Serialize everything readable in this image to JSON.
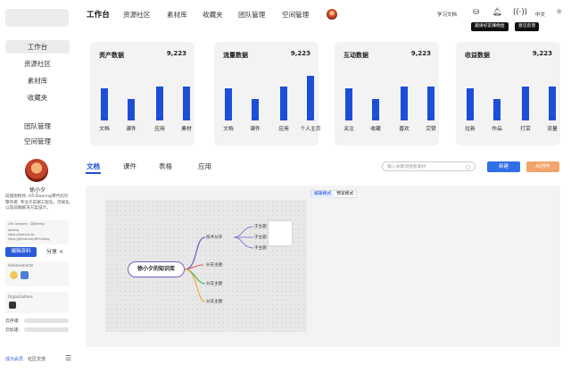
{
  "sidebar": {
    "nav": [
      "工作台",
      "资源社区",
      "素材库",
      "收藏夹"
    ],
    "nav2": [
      "团队管理",
      "空间管理"
    ],
    "profile": {
      "name": "徐小夕",
      "bio": "前端架构师, H5-Dooring零代码引擎作者, 专注于前端工程化、可视化, 以及前端解决方案设计。",
      "card_company": "Life Company · 共Nothing",
      "card_links": [
        "dooring",
        "https://dooring.vip",
        "https://github.com/MrXujiang"
      ],
      "edit_label": "编辑资料",
      "share_label": "分享",
      "achievements": "Achievements",
      "organizations": "Organizations"
    },
    "storage_cloud": "云存储:",
    "storage_ai": "云加速:",
    "member": "成为会员",
    "community": "社区交流"
  },
  "topnav": {
    "items": [
      "工作台",
      "资源社区",
      "素材库",
      "收藏夹",
      "团队管理",
      "空间管理"
    ],
    "docs": "学习文档",
    "lang": "中文",
    "tip_invite": "邀请好友赚佣金",
    "tip_feedback": "意见反馈"
  },
  "stats": [
    {
      "title": "资产数据",
      "total": "9,223",
      "bars": [
        {
          "label": "文档",
          "value": 64
        },
        {
          "label": "课件",
          "value": 42
        },
        {
          "label": "应用",
          "value": 68
        },
        {
          "label": "素材",
          "value": 68
        }
      ]
    },
    {
      "title": "流量数据",
      "total": "9,223",
      "bars": [
        {
          "label": "文档",
          "value": 64
        },
        {
          "label": "课件",
          "value": 42
        },
        {
          "label": "应用",
          "value": 68
        },
        {
          "label": "个人主页",
          "value": 90
        }
      ]
    },
    {
      "title": "互动数据",
      "total": "9,223",
      "bars": [
        {
          "label": "关注",
          "value": 64
        },
        {
          "label": "收藏",
          "value": 42
        },
        {
          "label": "喜欢",
          "value": 68
        },
        {
          "label": "完赞",
          "value": 68
        }
      ]
    },
    {
      "title": "收益数据",
      "total": "9,223",
      "bars": [
        {
          "label": "拉新",
          "value": 64
        },
        {
          "label": "作品",
          "value": 42
        },
        {
          "label": "打赏",
          "value": 68
        },
        {
          "label": "流量",
          "value": 68
        }
      ]
    }
  ],
  "tabs": [
    "文档",
    "课件",
    "表格",
    "应用"
  ],
  "search": {
    "placeholder": "输入关键词搜索素材"
  },
  "buttons": {
    "new": "新建",
    "ai": "AI创作"
  },
  "modes": [
    "编辑模式",
    "预览模式"
  ],
  "mindmap": {
    "root": "徐小夕的知识库",
    "branch1": "技术分享",
    "leaves1": [
      "子主题",
      "子主题",
      "子主题"
    ],
    "branches": [
      "分支主题",
      "分支主题",
      "分支主题",
      "分支主题"
    ]
  },
  "colors": {
    "primary": "#1d4ed8",
    "accent": "#f2a56b",
    "mind": "#7c5cc4"
  }
}
